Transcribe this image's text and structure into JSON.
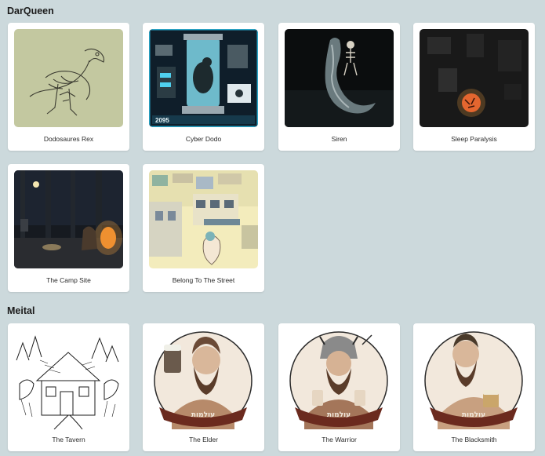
{
  "sections": [
    {
      "title": "DarQueen",
      "items": [
        {
          "label": "Dodosaures Rex"
        },
        {
          "label": "Cyber Dodo"
        },
        {
          "label": "Siren"
        },
        {
          "label": "Sleep Paralysis"
        },
        {
          "label": "The Camp Site"
        },
        {
          "label": "Belong To The Street"
        }
      ]
    },
    {
      "title": "Meital",
      "items": [
        {
          "label": "The Tavern"
        },
        {
          "label": "The Elder"
        },
        {
          "label": "The Warrior"
        },
        {
          "label": "The Blacksmith"
        }
      ]
    }
  ],
  "artwork_text": {
    "cyber_dodo_year": "2095"
  }
}
